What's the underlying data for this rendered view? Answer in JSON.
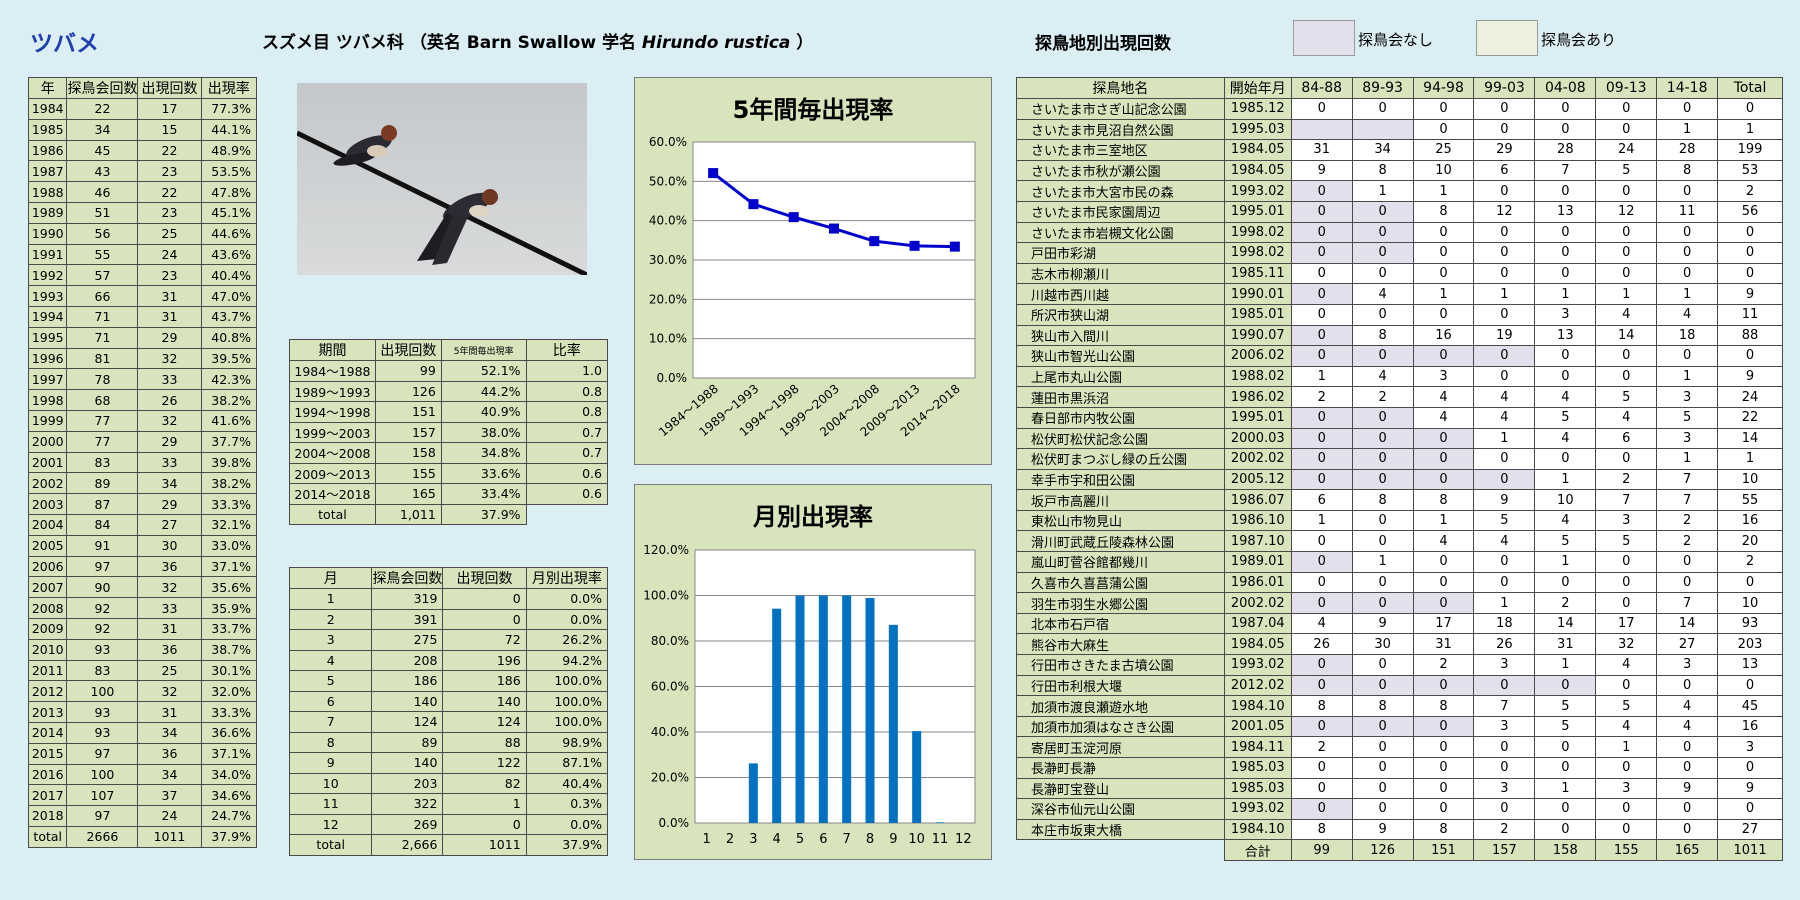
{
  "species": "ツバメ",
  "header": {
    "prefix": "スズメ目 ツバメ科 （英名 Barn Swallow 学名 ",
    "sci": "Hirundo rustica",
    "suffix": " ）"
  },
  "area_title": "探鳥地別出現回数",
  "legend": {
    "none": "探鳥会なし",
    "some": "探鳥会あり",
    "none_color": "#e4dfec",
    "some_color": "#ebf1de"
  },
  "yearly": {
    "headers": [
      "年",
      "探鳥会回数",
      "出現回数",
      "出現率"
    ],
    "rows": [
      [
        "1984",
        "22",
        "17",
        "77.3%"
      ],
      [
        "1985",
        "34",
        "15",
        "44.1%"
      ],
      [
        "1986",
        "45",
        "22",
        "48.9%"
      ],
      [
        "1987",
        "43",
        "23",
        "53.5%"
      ],
      [
        "1988",
        "46",
        "22",
        "47.8%"
      ],
      [
        "1989",
        "51",
        "23",
        "45.1%"
      ],
      [
        "1990",
        "56",
        "25",
        "44.6%"
      ],
      [
        "1991",
        "55",
        "24",
        "43.6%"
      ],
      [
        "1992",
        "57",
        "23",
        "40.4%"
      ],
      [
        "1993",
        "66",
        "31",
        "47.0%"
      ],
      [
        "1994",
        "71",
        "31",
        "43.7%"
      ],
      [
        "1995",
        "71",
        "29",
        "40.8%"
      ],
      [
        "1996",
        "81",
        "32",
        "39.5%"
      ],
      [
        "1997",
        "78",
        "33",
        "42.3%"
      ],
      [
        "1998",
        "68",
        "26",
        "38.2%"
      ],
      [
        "1999",
        "77",
        "32",
        "41.6%"
      ],
      [
        "2000",
        "77",
        "29",
        "37.7%"
      ],
      [
        "2001",
        "83",
        "33",
        "39.8%"
      ],
      [
        "2002",
        "89",
        "34",
        "38.2%"
      ],
      [
        "2003",
        "87",
        "29",
        "33.3%"
      ],
      [
        "2004",
        "84",
        "27",
        "32.1%"
      ],
      [
        "2005",
        "91",
        "30",
        "33.0%"
      ],
      [
        "2006",
        "97",
        "36",
        "37.1%"
      ],
      [
        "2007",
        "90",
        "32",
        "35.6%"
      ],
      [
        "2008",
        "92",
        "33",
        "35.9%"
      ],
      [
        "2009",
        "92",
        "31",
        "33.7%"
      ],
      [
        "2010",
        "93",
        "36",
        "38.7%"
      ],
      [
        "2011",
        "83",
        "25",
        "30.1%"
      ],
      [
        "2012",
        "100",
        "32",
        "32.0%"
      ],
      [
        "2013",
        "93",
        "31",
        "33.3%"
      ],
      [
        "2014",
        "93",
        "34",
        "36.6%"
      ],
      [
        "2015",
        "97",
        "36",
        "37.1%"
      ],
      [
        "2016",
        "100",
        "34",
        "34.0%"
      ],
      [
        "2017",
        "107",
        "37",
        "34.6%"
      ],
      [
        "2018",
        "97",
        "24",
        "24.7%"
      ]
    ],
    "total": [
      "total",
      "2666",
      "1011",
      "37.9%"
    ]
  },
  "period": {
    "headers": [
      "期間",
      "出現回数",
      "5年間毎出現率",
      "比率"
    ],
    "rows": [
      [
        "1984～1988",
        "99",
        "52.1%",
        "1.0"
      ],
      [
        "1989～1993",
        "126",
        "44.2%",
        "0.8"
      ],
      [
        "1994～1998",
        "151",
        "40.9%",
        "0.8"
      ],
      [
        "1999～2003",
        "157",
        "38.0%",
        "0.7"
      ],
      [
        "2004～2008",
        "158",
        "34.8%",
        "0.7"
      ],
      [
        "2009～2013",
        "155",
        "33.6%",
        "0.6"
      ],
      [
        "2014～2018",
        "165",
        "33.4%",
        "0.6"
      ]
    ],
    "total": [
      "total",
      "1,011",
      "37.9%"
    ]
  },
  "monthly": {
    "headers": [
      "月",
      "探鳥会回数",
      "出現回数",
      "月別出現率"
    ],
    "rows": [
      [
        "1",
        "319",
        "0",
        "0.0%"
      ],
      [
        "2",
        "391",
        "0",
        "0.0%"
      ],
      [
        "3",
        "275",
        "72",
        "26.2%"
      ],
      [
        "4",
        "208",
        "196",
        "94.2%"
      ],
      [
        "5",
        "186",
        "186",
        "100.0%"
      ],
      [
        "6",
        "140",
        "140",
        "100.0%"
      ],
      [
        "7",
        "124",
        "124",
        "100.0%"
      ],
      [
        "8",
        "89",
        "88",
        "98.9%"
      ],
      [
        "9",
        "140",
        "122",
        "87.1%"
      ],
      [
        "10",
        "203",
        "82",
        "40.4%"
      ],
      [
        "11",
        "322",
        "1",
        "0.3%"
      ],
      [
        "12",
        "269",
        "0",
        "0.0%"
      ]
    ],
    "total": [
      "total",
      "2,666",
      "1011",
      "37.9%"
    ]
  },
  "sites": {
    "headers": [
      "探鳥地名",
      "開始年月",
      "84-88",
      "89-93",
      "94-98",
      "99-03",
      "04-08",
      "09-13",
      "14-18",
      "Total"
    ],
    "rows": [
      [
        "さいたま市さぎ山記念公園",
        "1985.12",
        [
          "0",
          "0",
          "0",
          "0",
          "0",
          "0",
          "0"
        ],
        "0",
        []
      ],
      [
        "さいたま市見沼自然公園",
        "1995.03",
        [
          "",
          "",
          "0",
          "0",
          "0",
          "0",
          "1"
        ],
        "1",
        [
          0,
          1
        ]
      ],
      [
        "さいたま市三室地区",
        "1984.05",
        [
          "31",
          "34",
          "25",
          "29",
          "28",
          "24",
          "28"
        ],
        "199",
        []
      ],
      [
        "さいたま市秋が瀬公園",
        "1984.05",
        [
          "9",
          "8",
          "10",
          "6",
          "7",
          "5",
          "8"
        ],
        "53",
        []
      ],
      [
        "さいたま市大宮市民の森",
        "1993.02",
        [
          "0",
          "1",
          "1",
          "0",
          "0",
          "0",
          "0"
        ],
        "2",
        [
          0
        ]
      ],
      [
        "さいたま市民家園周辺",
        "1995.01",
        [
          "0",
          "0",
          "8",
          "12",
          "13",
          "12",
          "11"
        ],
        "56",
        [
          0,
          1
        ]
      ],
      [
        "さいたま市岩槻文化公園",
        "1998.02",
        [
          "0",
          "0",
          "0",
          "0",
          "0",
          "0",
          "0"
        ],
        "0",
        [
          0,
          1
        ]
      ],
      [
        "戸田市彩湖",
        "1998.02",
        [
          "0",
          "0",
          "0",
          "0",
          "0",
          "0",
          "0"
        ],
        "0",
        [
          0,
          1
        ]
      ],
      [
        "志木市柳瀬川",
        "1985.11",
        [
          "0",
          "0",
          "0",
          "0",
          "0",
          "0",
          "0"
        ],
        "0",
        []
      ],
      [
        "川越市西川越",
        "1990.01",
        [
          "0",
          "4",
          "1",
          "1",
          "1",
          "1",
          "1"
        ],
        "9",
        [
          0
        ]
      ],
      [
        "所沢市狭山湖",
        "1985.01",
        [
          "0",
          "0",
          "0",
          "0",
          "3",
          "4",
          "4"
        ],
        "11",
        []
      ],
      [
        "狭山市入間川",
        "1990.07",
        [
          "0",
          "8",
          "16",
          "19",
          "13",
          "14",
          "18"
        ],
        "88",
        [
          0
        ]
      ],
      [
        "狭山市智光山公園",
        "2006.02",
        [
          "0",
          "0",
          "0",
          "0",
          "0",
          "0",
          "0"
        ],
        "0",
        [
          0,
          1,
          2,
          3
        ]
      ],
      [
        "上尾市丸山公園",
        "1988.02",
        [
          "1",
          "4",
          "3",
          "0",
          "0",
          "0",
          "1"
        ],
        "9",
        []
      ],
      [
        "蓮田市黒浜沼",
        "1986.02",
        [
          "2",
          "2",
          "4",
          "4",
          "4",
          "5",
          "3"
        ],
        "24",
        []
      ],
      [
        "春日部市内牧公園",
        "1995.01",
        [
          "0",
          "0",
          "4",
          "4",
          "5",
          "4",
          "5"
        ],
        "22",
        [
          0,
          1
        ]
      ],
      [
        "松伏町松伏記念公園",
        "2000.03",
        [
          "0",
          "0",
          "0",
          "1",
          "4",
          "6",
          "3"
        ],
        "14",
        [
          0,
          1,
          2
        ]
      ],
      [
        "松伏町まつぶし緑の丘公園",
        "2002.02",
        [
          "0",
          "0",
          "0",
          "0",
          "0",
          "0",
          "1"
        ],
        "1",
        [
          0,
          1,
          2
        ]
      ],
      [
        "幸手市宇和田公園",
        "2005.12",
        [
          "0",
          "0",
          "0",
          "0",
          "1",
          "2",
          "7"
        ],
        "10",
        [
          0,
          1,
          2,
          3
        ]
      ],
      [
        "坂戸市高麗川",
        "1986.07",
        [
          "6",
          "8",
          "8",
          "9",
          "10",
          "7",
          "7"
        ],
        "55",
        []
      ],
      [
        "東松山市物見山",
        "1986.10",
        [
          "1",
          "0",
          "1",
          "5",
          "4",
          "3",
          "2"
        ],
        "16",
        []
      ],
      [
        "滑川町武蔵丘陵森林公園",
        "1987.10",
        [
          "0",
          "0",
          "4",
          "4",
          "5",
          "5",
          "2"
        ],
        "20",
        []
      ],
      [
        "嵐山町菅谷館都幾川",
        "1989.01",
        [
          "0",
          "1",
          "0",
          "0",
          "1",
          "0",
          "0"
        ],
        "2",
        [
          0
        ]
      ],
      [
        "久喜市久喜菖蒲公園",
        "1986.01",
        [
          "0",
          "0",
          "0",
          "0",
          "0",
          "0",
          "0"
        ],
        "0",
        []
      ],
      [
        "羽生市羽生水郷公園",
        "2002.02",
        [
          "0",
          "0",
          "0",
          "1",
          "2",
          "0",
          "7"
        ],
        "10",
        [
          0,
          1,
          2
        ]
      ],
      [
        "北本市石戸宿",
        "1987.04",
        [
          "4",
          "9",
          "17",
          "18",
          "14",
          "17",
          "14"
        ],
        "93",
        []
      ],
      [
        "熊谷市大麻生",
        "1984.05",
        [
          "26",
          "30",
          "31",
          "26",
          "31",
          "32",
          "27"
        ],
        "203",
        []
      ],
      [
        "行田市さきたま古墳公園",
        "1993.02",
        [
          "0",
          "0",
          "2",
          "3",
          "1",
          "4",
          "3"
        ],
        "13",
        [
          0
        ]
      ],
      [
        "行田市利根大堰",
        "2012.02",
        [
          "0",
          "0",
          "0",
          "0",
          "0",
          "0",
          "0"
        ],
        "0",
        [
          0,
          1,
          2,
          3,
          4
        ]
      ],
      [
        "加須市渡良瀬遊水地",
        "1984.10",
        [
          "8",
          "8",
          "8",
          "7",
          "5",
          "5",
          "4"
        ],
        "45",
        []
      ],
      [
        "加須市加須はなさき公園",
        "2001.05",
        [
          "0",
          "0",
          "0",
          "3",
          "5",
          "4",
          "4"
        ],
        "16",
        [
          0,
          1,
          2
        ]
      ],
      [
        "寄居町玉淀河原",
        "1984.11",
        [
          "2",
          "0",
          "0",
          "0",
          "0",
          "1",
          "0"
        ],
        "3",
        []
      ],
      [
        "長瀞町長瀞",
        "1985.03",
        [
          "0",
          "0",
          "0",
          "0",
          "0",
          "0",
          "0"
        ],
        "0",
        []
      ],
      [
        "長瀞町宝登山",
        "1985.03",
        [
          "0",
          "0",
          "0",
          "3",
          "1",
          "3",
          "9"
        ],
        "9",
        []
      ],
      [
        "深谷市仙元山公園",
        "1993.02",
        [
          "0",
          "0",
          "0",
          "0",
          "0",
          "0",
          "0"
        ],
        "0",
        [
          0
        ]
      ],
      [
        "本庄市坂東大橋",
        "1984.10",
        [
          "8",
          "9",
          "8",
          "2",
          "0",
          "0",
          "0"
        ],
        "27",
        []
      ]
    ],
    "sum": [
      "合計",
      "99",
      "126",
      "151",
      "157",
      "158",
      "155",
      "165",
      "1011"
    ]
  },
  "chart_data": [
    {
      "type": "line",
      "title": "5年間毎出現率",
      "categories": [
        "1984～1988",
        "1989～1993",
        "1994～1998",
        "1999～2003",
        "2004～2008",
        "2009～2013",
        "2014～2018"
      ],
      "values": [
        52.1,
        44.2,
        40.9,
        38.0,
        34.8,
        33.6,
        33.4
      ],
      "ylim": [
        0,
        60
      ],
      "yticks": [
        "0.0%",
        "10.0%",
        "20.0%",
        "30.0%",
        "40.0%",
        "50.0%",
        "60.0%"
      ],
      "grid": true,
      "color": "#0000cc"
    },
    {
      "type": "bar",
      "title": "月別出現率",
      "categories": [
        "1",
        "2",
        "3",
        "4",
        "5",
        "6",
        "7",
        "8",
        "9",
        "10",
        "11",
        "12"
      ],
      "values": [
        0.0,
        0.0,
        26.2,
        94.2,
        100.0,
        100.0,
        100.0,
        98.9,
        87.1,
        40.4,
        0.3,
        0.0
      ],
      "ylim": [
        0,
        120
      ],
      "yticks": [
        "0.0%",
        "20.0%",
        "40.0%",
        "60.0%",
        "80.0%",
        "100.0%",
        "120.0%"
      ],
      "grid": true,
      "color": "#0070c0"
    }
  ]
}
